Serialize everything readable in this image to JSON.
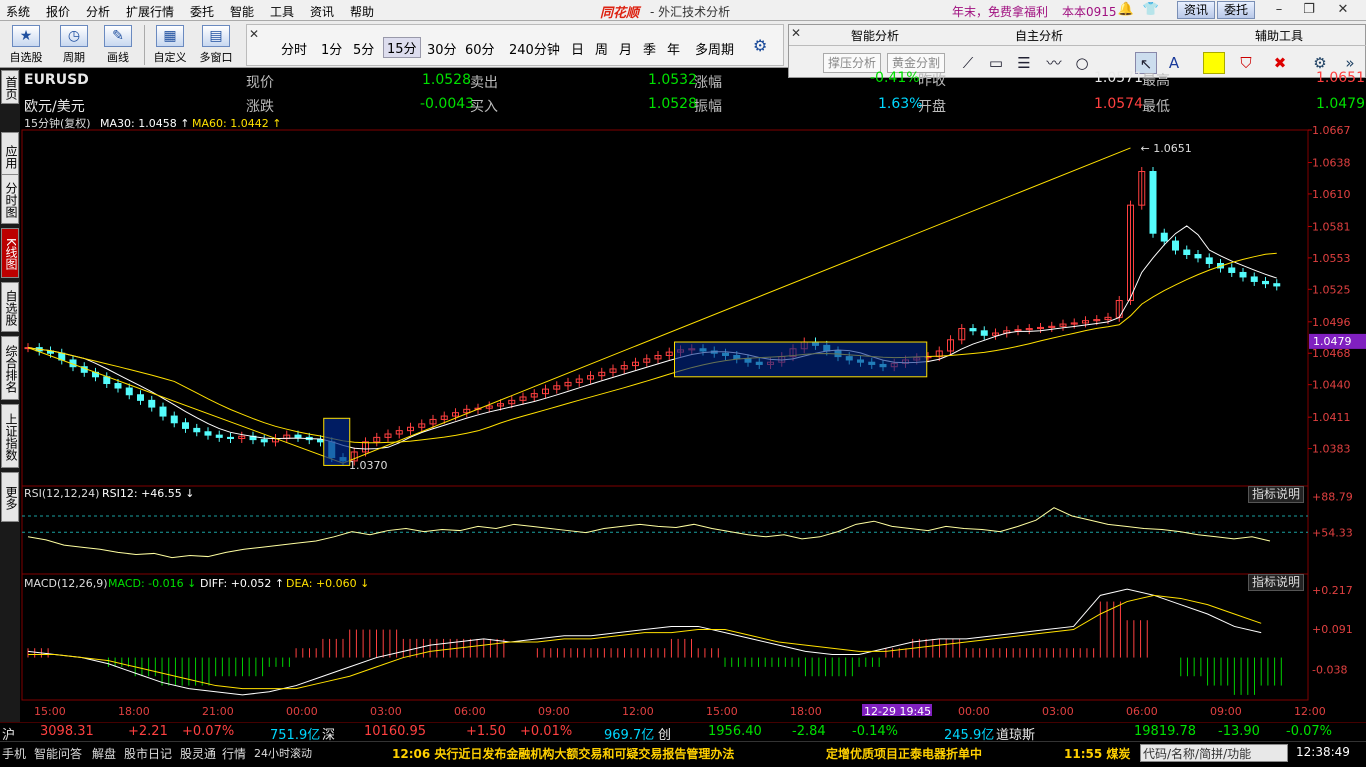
{
  "menubar": {
    "items": [
      "系统",
      "报价",
      "分析",
      "扩展行情",
      "委托",
      "智能",
      "工具",
      "资讯",
      "帮助"
    ],
    "logo": "同花顺",
    "title": "- 外汇技术分析",
    "promo": "年末，免费拿福利",
    "version": "本本0915",
    "btn_news": "资讯",
    "btn_trade": "委托"
  },
  "toolbar": {
    "buttons": [
      "自选股",
      "周期",
      "画线",
      "自定义",
      "多窗口"
    ],
    "periods": [
      "分时",
      "1分",
      "5分",
      "15分",
      "30分",
      "60分",
      "240分钟",
      "日",
      "周",
      "月",
      "季",
      "年",
      "多周期"
    ],
    "active_period": "15分"
  },
  "tool_panel": {
    "tabs": [
      "智能分析",
      "自主分析",
      "辅助工具"
    ],
    "btn1": "撑压分析",
    "btn2": "黄金分割"
  },
  "leftbar": {
    "tabs": [
      "首页",
      "应用",
      "分时图",
      "K线图",
      "自选股",
      "综合排名",
      "上证指数",
      "更多"
    ],
    "active": "K线图"
  },
  "info": {
    "symbol": "EURUSD",
    "name": "欧元/美元",
    "l1": "现价",
    "v1": "1.0528",
    "l2": "卖出",
    "v2": "1.0532",
    "l3": "涨幅",
    "v3": "-0.41%",
    "l4": "昨收",
    "v4": "1.0571",
    "l5": "最高",
    "v5": "1.0651",
    "l6": "涨跌",
    "v6": "-0.0043",
    "l7": "买入",
    "v7": "1.0528",
    "l8": "振幅",
    "v8": "1.63%",
    "l9": "开盘",
    "v9": "1.0574",
    "l10": "最低",
    "v10": "1.0479"
  },
  "chart_legend": {
    "period": "15分钟(复权)",
    "ma30": "MA30: 1.0458",
    "ma60": "MA60: 1.0442",
    "rsi": "RSI(12,12,24)",
    "rsi12": "RSI12: +46.55",
    "macd": "MACD(12,26,9)",
    "macd_v": "MACD: -0.016",
    "diff": "DIFF: +0.052",
    "dea": "DEA: +0.060",
    "ind_btn": "指标说明",
    "ind_btn2": "指标说明"
  },
  "chart_data": {
    "type": "candlestick",
    "price_ticks": [
      "1.0667",
      "1.0638",
      "1.0610",
      "1.0581",
      "1.0553",
      "1.0525",
      "1.0496",
      "1.0468",
      "1.0440",
      "1.0411",
      "1.0383"
    ],
    "highlight_price": "1.0479",
    "annotations": [
      "1.0651",
      "1.0370"
    ],
    "rsi_ticks": [
      "+88.79",
      "+54.33"
    ],
    "macd_ticks": [
      "+0.217",
      "+0.091",
      "-0.038"
    ],
    "x_ticks": [
      "15:00",
      "18:00",
      "21:00",
      "00:00",
      "03:00",
      "06:00",
      "09:00",
      "12:00",
      "15:00",
      "18:00",
      "12-29 19:45",
      "00:00",
      "03:00",
      "06:00",
      "09:00",
      "12:00"
    ],
    "ylim": [
      1.0355,
      1.0667
    ],
    "closes": [
      1.0473,
      1.047,
      1.0468,
      1.0462,
      1.0456,
      1.0451,
      1.0447,
      1.0441,
      1.0437,
      1.0431,
      1.0426,
      1.042,
      1.0412,
      1.0406,
      1.0401,
      1.0398,
      1.0395,
      1.0393,
      1.0392,
      1.0394,
      1.0391,
      1.0389,
      1.0392,
      1.0395,
      1.0393,
      1.0391,
      1.0389,
      1.0375,
      1.0372,
      1.038,
      1.0389,
      1.0393,
      1.0396,
      1.0399,
      1.0402,
      1.0405,
      1.0409,
      1.0412,
      1.0415,
      1.0418,
      1.0419,
      1.0421,
      1.0423,
      1.0426,
      1.0429,
      1.0432,
      1.0436,
      1.0439,
      1.0442,
      1.0445,
      1.0448,
      1.0451,
      1.0454,
      1.0457,
      1.046,
      1.0463,
      1.0466,
      1.0469,
      1.0471,
      1.0472,
      1.047,
      1.0468,
      1.0466,
      1.0463,
      1.046,
      1.0458,
      1.046,
      1.0465,
      1.0472,
      1.0478,
      1.0475,
      1.047,
      1.0465,
      1.0462,
      1.046,
      1.0458,
      1.0456,
      1.0459,
      1.0462,
      1.0464,
      1.0465,
      1.047,
      1.048,
      1.049,
      1.0488,
      1.0484,
      1.0486,
      1.0488,
      1.0489,
      1.049,
      1.0491,
      1.0492,
      1.0494,
      1.0495,
      1.0497,
      1.0498,
      1.05,
      1.0515,
      1.06,
      1.063,
      1.0575,
      1.0568,
      1.056,
      1.0556,
      1.0553,
      1.0548,
      1.0544,
      1.054,
      1.0536,
      1.0532,
      1.053,
      1.0528
    ],
    "rsi": [
      50,
      47,
      42,
      40,
      38,
      35,
      33,
      34,
      30,
      32,
      31,
      35,
      38,
      40,
      42,
      44,
      46,
      50,
      55,
      52,
      56,
      58,
      55,
      57,
      56,
      60,
      58,
      62,
      60,
      58,
      56,
      54,
      58,
      60,
      62,
      60,
      59,
      62,
      58,
      55,
      52,
      50,
      52,
      48,
      50,
      55,
      62,
      65,
      60,
      58,
      56,
      60,
      58,
      57,
      55,
      60,
      66,
      78,
      70,
      66,
      62,
      60,
      58,
      57,
      55,
      52,
      50,
      48,
      50,
      46
    ],
    "macd_dif": [
      0.02,
      0.01,
      0,
      -0.02,
      -0.05,
      -0.08,
      -0.1,
      -0.11,
      -0.12,
      -0.11,
      -0.09,
      -0.06,
      -0.03,
      0,
      0.02,
      0.04,
      0.05,
      0.06,
      0.05,
      0.06,
      0.07,
      0.07,
      0.08,
      0.09,
      0.1,
      0.1,
      0.08,
      0.06,
      0.04,
      0.02,
      0.01,
      0.01,
      0.03,
      0.05,
      0.06,
      0.06,
      0.07,
      0.08,
      0.09,
      0.1,
      0.2,
      0.22,
      0.2,
      0.17,
      0.14,
      0.1,
      0.08
    ],
    "macd_dea": [
      0.01,
      0.01,
      0,
      -0.01,
      -0.03,
      -0.05,
      -0.07,
      -0.09,
      -0.1,
      -0.1,
      -0.1,
      -0.08,
      -0.06,
      -0.03,
      0,
      0.02,
      0.03,
      0.04,
      0.05,
      0.05,
      0.06,
      0.06,
      0.07,
      0.08,
      0.08,
      0.09,
      0.09,
      0.07,
      0.05,
      0.04,
      0.03,
      0.02,
      0.02,
      0.03,
      0.04,
      0.05,
      0.06,
      0.07,
      0.08,
      0.09,
      0.14,
      0.18,
      0.2,
      0.19,
      0.17,
      0.14,
      0.11
    ]
  },
  "bottom_quotes": {
    "sh_label": "沪",
    "sh_val": "3098.31",
    "sh_chg": "+2.21",
    "sh_pct": "+0.07%",
    "sh_amt": "751.9亿",
    "sz_label": "深",
    "sz_val": "10160.95",
    "sz_chg": "+1.50",
    "sz_pct": "+0.01%",
    "sz_amt": "969.7亿",
    "cy_label": "创",
    "cy_val": "1956.40",
    "cy_chg": "-2.84",
    "cy_pct": "-0.14%",
    "cy_amt": "245.9亿",
    "dj_label": "道琼斯",
    "dj_val": "19819.78",
    "dj_chg": "-13.90",
    "dj_pct": "-0.07%"
  },
  "statusbar": {
    "tabs": [
      "手机",
      "智能问答",
      "解盘",
      "股市日记",
      "股灵通",
      "行情",
      "24小时滚动"
    ],
    "news1": "12:06 央行近日发布金融机构大额交易和可疑交易报告管理办法",
    "news2": "定增优质项目正泰电器折单中",
    "news3": "11:55 煤炭",
    "search": "代码/名称/简拼/功能",
    "clock": "12:38:49"
  }
}
